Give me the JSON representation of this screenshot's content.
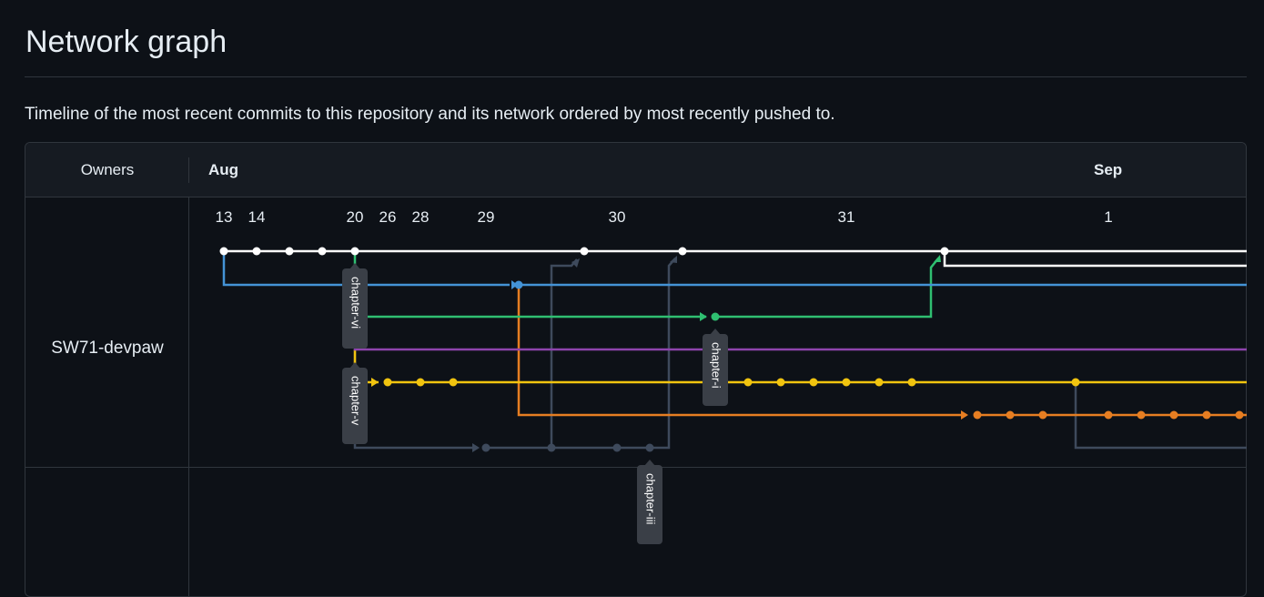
{
  "page": {
    "title": "Network graph",
    "description": "Timeline of the most recent commits to this repository and its network ordered by most recently pushed to."
  },
  "graph": {
    "owners_header": "Owners",
    "months": [
      "Aug",
      "Sep"
    ],
    "days": [
      "13",
      "14",
      "20",
      "26",
      "28",
      "29",
      "30",
      "31",
      "1"
    ],
    "owners": [
      "SW71-devpaw"
    ],
    "branch_labels": [
      "chapter-vi",
      "chapter-v",
      "chapter-i",
      "chapter-iii"
    ],
    "colors": {
      "master": "#ffffff",
      "blue": "#4493d6",
      "green": "#2fbf71",
      "purple": "#8e44ad",
      "yellow": "#f1c40f",
      "orange": "#e67e22",
      "slate": "#3e4a5c",
      "label_bg": "#3a3f47"
    }
  }
}
